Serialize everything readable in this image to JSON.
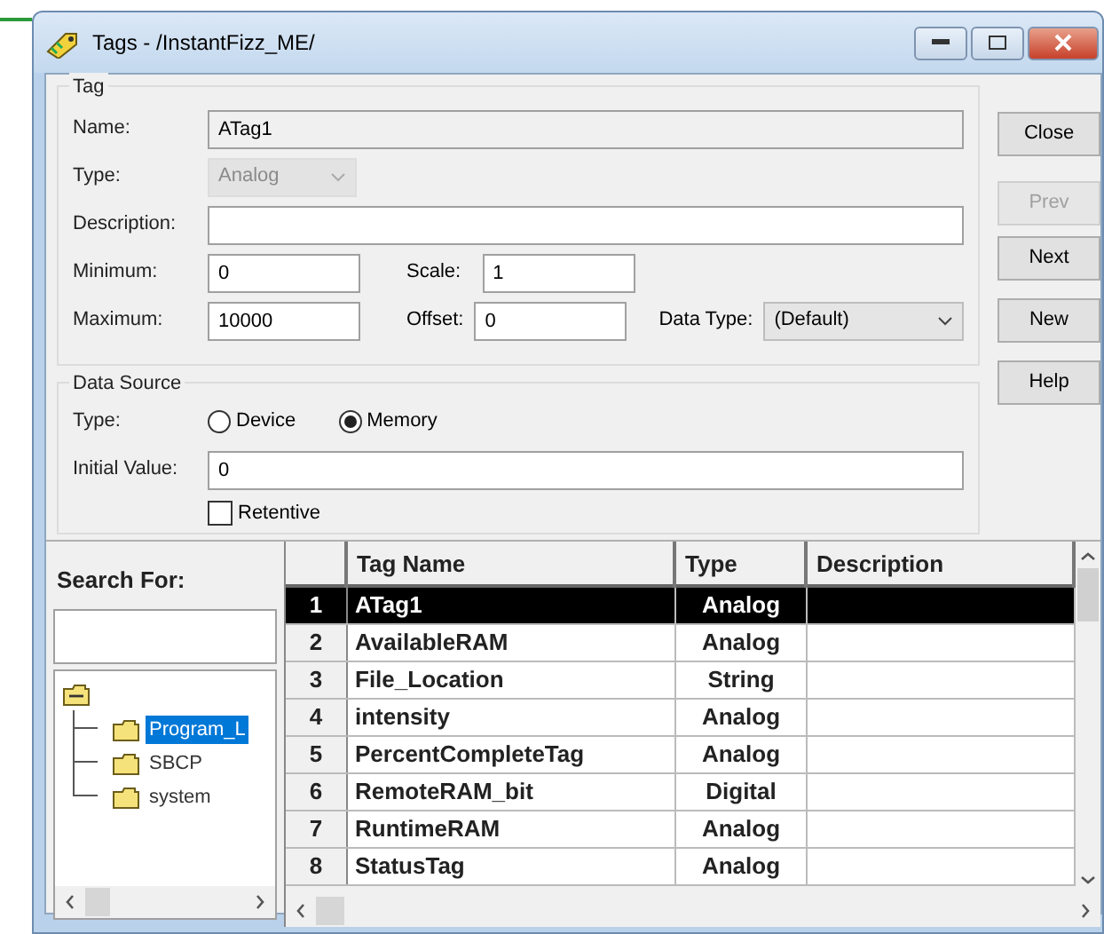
{
  "window": {
    "title": "Tags - /InstantFizz_ME/"
  },
  "tag_group": {
    "legend": "Tag",
    "name": {
      "label": "Name:",
      "value": "ATag1"
    },
    "type": {
      "label": "Type:",
      "value": "Analog",
      "disabled": true
    },
    "description": {
      "label": "Description:"
    },
    "minimum": {
      "label": "Minimum:",
      "value": "0"
    },
    "scale": {
      "label": "Scale:",
      "value": "1"
    },
    "maximum": {
      "label": "Maximum:",
      "value": "10000"
    },
    "offset": {
      "label": "Offset:",
      "value": "0"
    },
    "data_type": {
      "label": "Data Type:",
      "value": "(Default)",
      "disabled": false
    }
  },
  "buttons": [
    {
      "label": "Close",
      "disabled": false
    },
    {
      "label": "Prev",
      "disabled": true
    },
    {
      "label": "Next",
      "disabled": false
    },
    {
      "label": "New",
      "disabled": false
    },
    {
      "label": "Help",
      "disabled": false
    }
  ],
  "data_source": {
    "legend": "Data Source",
    "type_label": "Type:",
    "options": [
      {
        "label": "Device",
        "selected": false
      },
      {
        "label": "Memory",
        "selected": true
      }
    ],
    "initial_value": {
      "label": "Initial Value:",
      "value": "0"
    },
    "retentive": {
      "label": "Retentive",
      "checked": false
    }
  },
  "search": {
    "label": "Search For:"
  },
  "tree": {
    "expanded": true,
    "children": [
      {
        "label": "Program_L",
        "selected": true
      },
      {
        "label": "SBCP",
        "selected": false
      },
      {
        "label": "system",
        "selected": false
      }
    ]
  },
  "table": {
    "columns": [
      "Tag Name",
      "Type",
      "Description"
    ],
    "rows": [
      {
        "number": "1",
        "name": "ATag1",
        "type": "Analog",
        "selected": true
      },
      {
        "number": "2",
        "name": "AvailableRAM",
        "type": "Analog",
        "selected": false
      },
      {
        "number": "3",
        "name": "File_Location",
        "type": "String",
        "selected": false
      },
      {
        "number": "4",
        "name": "intensity",
        "type": "Analog",
        "selected": false
      },
      {
        "number": "5",
        "name": "PercentCompleteTag",
        "type": "Analog",
        "selected": false
      },
      {
        "number": "6",
        "name": "RemoteRAM_bit",
        "type": "Digital",
        "selected": false
      },
      {
        "number": "7",
        "name": "RuntimeRAM",
        "type": "Analog",
        "selected": false
      },
      {
        "number": "8",
        "name": "StatusTag",
        "type": "Analog",
        "selected": false
      }
    ]
  }
}
